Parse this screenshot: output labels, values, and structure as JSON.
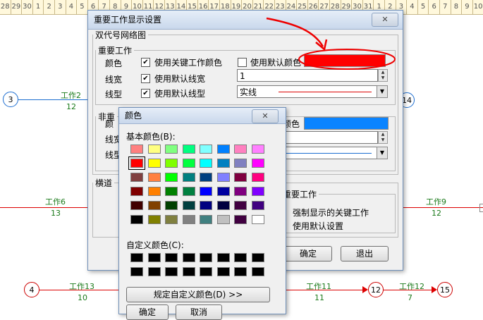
{
  "ruler": [
    "28",
    "29",
    "30",
    "1",
    "2",
    "3",
    "4",
    "5",
    "6",
    "7",
    "8",
    "9",
    "10",
    "11",
    "12",
    "13",
    "14",
    "15",
    "16",
    "17",
    "18",
    "19",
    "20",
    "21",
    "22",
    "23",
    "24",
    "25",
    "26",
    "27",
    "28",
    "29",
    "30",
    "31",
    "1",
    "2",
    "3",
    "4",
    "5",
    "6",
    "7",
    "8",
    "9",
    "10"
  ],
  "network": {
    "nodes": {
      "n3": "3",
      "n14": "14",
      "n4": "4",
      "n12": "12",
      "n15": "15"
    },
    "works": [
      {
        "name": "工作2",
        "days": "12"
      },
      {
        "name": "工作6",
        "days": "13"
      },
      {
        "name": "工作9",
        "days": "12"
      },
      {
        "name": "工作13",
        "days": "10"
      },
      {
        "name": "工作11",
        "days": "11"
      },
      {
        "name": "工作12",
        "days": "7"
      }
    ]
  },
  "settings": {
    "title": "重要工作显示设置",
    "close": "✕",
    "group_main": "双代号网络图",
    "important": {
      "legend": "重要工作",
      "color_label": "颜色",
      "use_key_color": "使用关键工作颜色",
      "use_default_color": "使用默认颜色",
      "color_value": "#ff0000",
      "width_label": "线宽",
      "use_default_width": "使用默认线宽",
      "width_value": "1",
      "type_label": "线型",
      "use_default_type": "使用默认线型",
      "type_value": "实线"
    },
    "nonimportant": {
      "legend_partial": "非重",
      "color_partial": "颜",
      "width_partial": "线宽",
      "type_partial": "线型",
      "color_label_tail": "颜色",
      "color_value": "#0a84ff"
    },
    "horizontal_partial": "横道",
    "right_group": {
      "legend": "重要工作",
      "opt1": "强制显示的关键工作",
      "opt2": "使用默认设置"
    },
    "ok": "确定",
    "exit": "退出"
  },
  "color_dialog": {
    "title": "颜色",
    "close": "✕",
    "basic_label": "基本颜色(B):",
    "custom_label": "自定义颜色(C):",
    "define_button": "规定自定义颜色(D) >>",
    "ok": "确定",
    "cancel": "取消",
    "basic_colors": [
      "#ff8080",
      "#ffff80",
      "#80ff80",
      "#00ff80",
      "#80ffff",
      "#0080ff",
      "#ff80c0",
      "#ff80ff",
      "#ff0000",
      "#ffff00",
      "#80ff00",
      "#00ff40",
      "#00ffff",
      "#0080c0",
      "#8080c0",
      "#ff00ff",
      "#804040",
      "#ff8040",
      "#00ff00",
      "#008080",
      "#004080",
      "#8080ff",
      "#800040",
      "#ff0080",
      "#800000",
      "#ff8000",
      "#008000",
      "#008040",
      "#0000ff",
      "#0000a0",
      "#800080",
      "#8000ff",
      "#400000",
      "#804000",
      "#004000",
      "#004040",
      "#000080",
      "#000040",
      "#400040",
      "#400080",
      "#000000",
      "#808000",
      "#808040",
      "#808080",
      "#408080",
      "#c0c0c0",
      "#400040",
      "#ffffff"
    ],
    "selected_index": 8
  }
}
